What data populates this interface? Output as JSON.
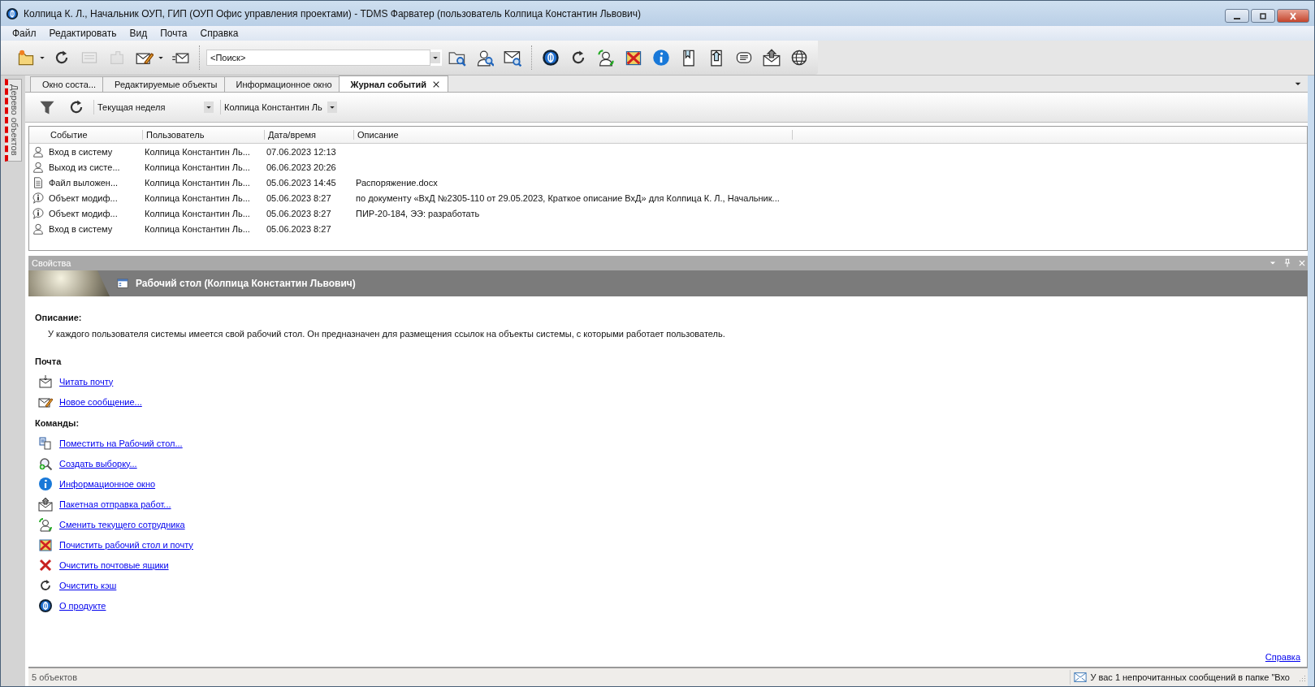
{
  "window": {
    "title": "Колпица К. Л., Начальник ОУП, ГИП (ОУП Офис управления проектами) - TDMS Фарватер (пользователь Колпица Константин Львович)"
  },
  "menu": [
    "Файл",
    "Редактировать",
    "Вид",
    "Почта",
    "Справка"
  ],
  "toolbar": {
    "left_buttons": [
      {
        "disabled": false
      },
      {
        "disabled": false
      },
      {
        "disabled": true
      },
      {
        "disabled": true
      },
      {
        "disabled": false
      },
      {
        "disabled": false
      }
    ],
    "search": {
      "placeholder": "<Поиск>"
    }
  },
  "side_panel": {
    "label": "Дерево объектов"
  },
  "tabs": [
    {
      "label": "Окно соста...",
      "selected": false
    },
    {
      "label": "Редактируемые объекты",
      "selected": false
    },
    {
      "label": "Информационное окно",
      "selected": false
    },
    {
      "label": "Журнал событий",
      "selected": true
    }
  ],
  "event_filter": {
    "period": "Текущая неделя",
    "user": "Колпица Константин Ль"
  },
  "table": {
    "columns": [
      "Событие",
      "Пользователь",
      "Дата/время",
      "Описание"
    ],
    "rows": [
      {
        "kind": "session",
        "event": "Вход в систему",
        "user": "Колпица Константин Ль...",
        "datetime": "07.06.2023 12:13",
        "description": ""
      },
      {
        "kind": "session",
        "event": "Выход из систе...",
        "user": "Колпица Константин Ль...",
        "datetime": "06.06.2023 20:26",
        "description": ""
      },
      {
        "kind": "file",
        "event": "Файл выложен...",
        "user": "Колпица Константин Ль...",
        "datetime": "05.06.2023 14:45",
        "description": "Распоряжение.docx"
      },
      {
        "kind": "modified",
        "event": "Объект модиф...",
        "user": "Колпица Константин Ль...",
        "datetime": "05.06.2023 8:27",
        "description": "по документу «ВхД №2305-110 от 29.05.2023, Краткое описание ВхД» для Колпица К. Л., Начальник..."
      },
      {
        "kind": "modified",
        "event": "Объект модиф...",
        "user": "Колпица Константин Ль...",
        "datetime": "05.06.2023 8:27",
        "description": "ПИР-20-184, ЭЭ: разработать"
      },
      {
        "kind": "session",
        "event": "Вход в систему",
        "user": "Колпица Константин Ль...",
        "datetime": "05.06.2023 8:27",
        "description": ""
      }
    ]
  },
  "properties": {
    "title": "Свойства",
    "header": "Рабочий стол (Колпица Константин Львович)",
    "description_label": "Описание:",
    "description": "У каждого пользователя системы имеется свой рабочий стол. Он предназначен для размещения ссылок на объекты системы, с которыми работает пользователь.",
    "sections": [
      {
        "title": "Почта",
        "links": [
          "Читать почту",
          "Новое сообщение..."
        ]
      },
      {
        "title": "Команды:",
        "links": [
          "Поместить на Рабочий стол...",
          "Создать выборку...",
          "Информационное окно",
          "Пакетная отправка работ...",
          "Сменить текущего сотрудника",
          "Почистить рабочий стол и почту",
          "Очистить почтовые ящики",
          "Очистить кэш",
          "О продукте"
        ]
      }
    ],
    "help_link": "Справка"
  },
  "status_bar": {
    "count": "5 объектов",
    "message": "У вас 1 непрочитанных сообщений в папке \"Вхо"
  }
}
